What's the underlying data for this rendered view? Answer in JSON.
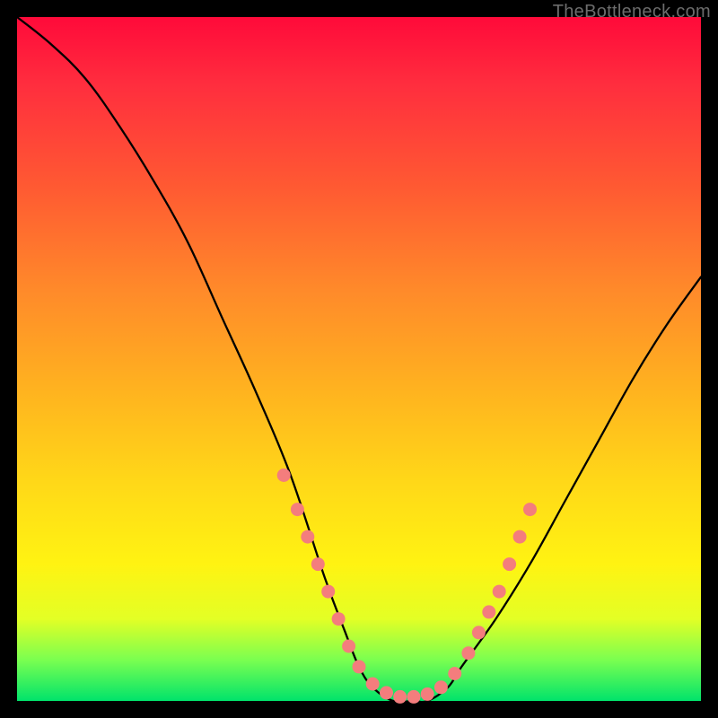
{
  "watermark": "TheBottleneck.com",
  "chart_data": {
    "type": "line",
    "title": "",
    "xlabel": "",
    "ylabel": "",
    "xlim": [
      0,
      100
    ],
    "ylim": [
      0,
      100
    ],
    "series": [
      {
        "name": "bottleneck-curve",
        "x": [
          0,
          5,
          10,
          15,
          20,
          25,
          30,
          35,
          40,
          45,
          48,
          50,
          52,
          55,
          58,
          60,
          63,
          65,
          70,
          75,
          80,
          85,
          90,
          95,
          100
        ],
        "values": [
          100,
          96,
          91,
          84,
          76,
          67,
          56,
          45,
          33,
          18,
          10,
          5,
          2,
          0,
          0,
          0,
          2,
          5,
          12,
          20,
          29,
          38,
          47,
          55,
          62
        ]
      }
    ],
    "markers": {
      "name": "highlight-dots",
      "color": "#f47d7d",
      "points": [
        {
          "x": 39,
          "y": 33
        },
        {
          "x": 41,
          "y": 28
        },
        {
          "x": 42.5,
          "y": 24
        },
        {
          "x": 44,
          "y": 20
        },
        {
          "x": 45.5,
          "y": 16
        },
        {
          "x": 47,
          "y": 12
        },
        {
          "x": 48.5,
          "y": 8
        },
        {
          "x": 50,
          "y": 5
        },
        {
          "x": 52,
          "y": 2.5
        },
        {
          "x": 54,
          "y": 1.2
        },
        {
          "x": 56,
          "y": 0.6
        },
        {
          "x": 58,
          "y": 0.6
        },
        {
          "x": 60,
          "y": 1.0
        },
        {
          "x": 62,
          "y": 2.0
        },
        {
          "x": 64,
          "y": 4.0
        },
        {
          "x": 66,
          "y": 7.0
        },
        {
          "x": 67.5,
          "y": 10
        },
        {
          "x": 69,
          "y": 13
        },
        {
          "x": 70.5,
          "y": 16
        },
        {
          "x": 72,
          "y": 20
        },
        {
          "x": 73.5,
          "y": 24
        },
        {
          "x": 75,
          "y": 28
        }
      ]
    }
  }
}
